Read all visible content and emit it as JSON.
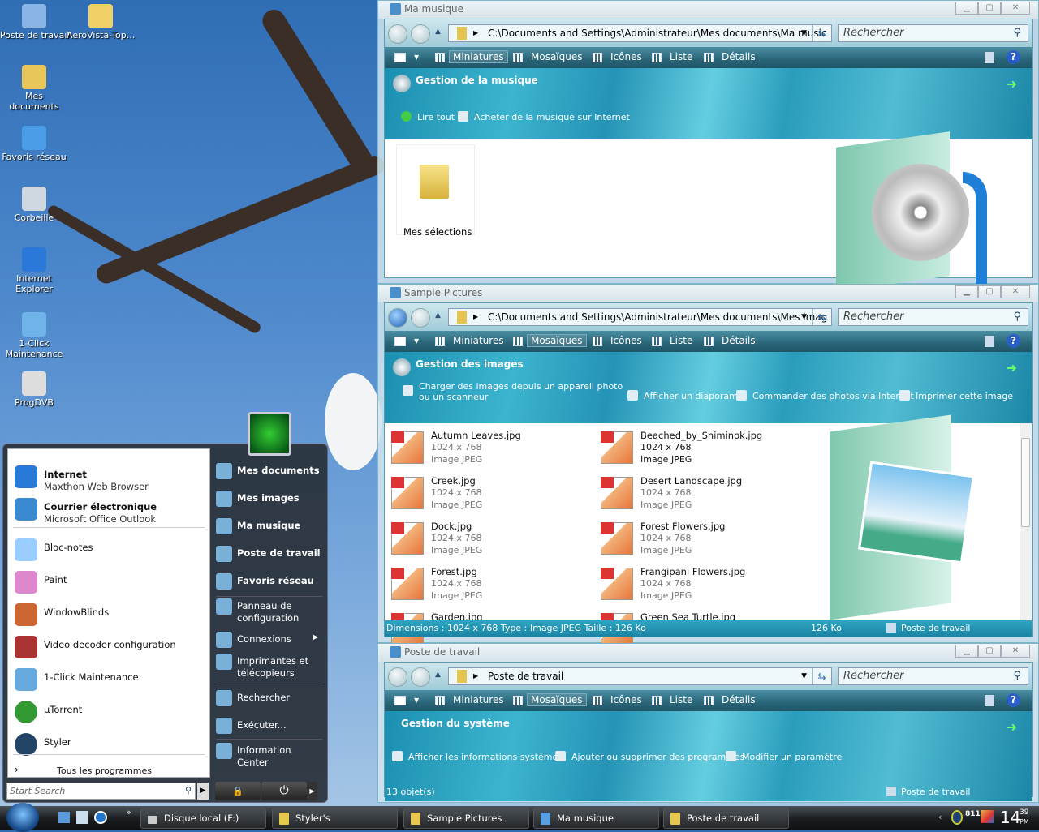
{
  "desktop": {
    "icons": [
      {
        "label": "Poste de travail",
        "icon": "computer-icon"
      },
      {
        "label": "AeroVista-Top...",
        "icon": "folder-icon"
      },
      {
        "label": "Mes documents",
        "icon": "documents-folder-icon"
      },
      {
        "label": "Favoris réseau",
        "icon": "network-icon"
      },
      {
        "label": "Corbeille",
        "icon": "recycle-bin-icon"
      },
      {
        "label": "Internet Explorer",
        "icon": "internet-explorer-icon"
      },
      {
        "label": "1-Click Maintenance",
        "icon": "maintenance-icon"
      },
      {
        "label": "ProgDVB",
        "icon": "satellite-dish-icon"
      }
    ]
  },
  "windows": [
    {
      "title": "Ma musique",
      "address": "C:\\Documents and Settings\\Administrateur\\Mes documents\\Ma music",
      "search": "Rechercher",
      "toolbar": [
        "Miniatures",
        "Mosaïques",
        "Icônes",
        "Liste",
        "Détails"
      ],
      "pane_title": "Gestion de la musique",
      "links": [
        "Lire tout",
        "Acheter de la musique sur Internet"
      ],
      "folders": [
        {
          "name": "Mes sélections"
        }
      ]
    },
    {
      "title": "Sample Pictures",
      "address": "C:\\Documents and Settings\\Administrateur\\Mes documents\\Mes imag",
      "search": "Rechercher",
      "toolbar": [
        "Miniatures",
        "Mosaïques",
        "Icônes",
        "Liste",
        "Détails"
      ],
      "pane_title": "Gestion des images",
      "links": [
        "Charger des images depuis un appareil photo ou un scanneur",
        "Afficher un diaporama",
        "Commander des photos via Internet",
        "Imprimer cette image"
      ],
      "files": [
        {
          "name": "Autumn Leaves.jpg",
          "dims": "1024 x 768",
          "type": "Image JPEG"
        },
        {
          "name": "Beached_by_Shiminok.jpg",
          "dims": "1024 x 768",
          "type": "Image JPEG"
        },
        {
          "name": "Creek.jpg",
          "dims": "1024 x 768",
          "type": "Image JPEG"
        },
        {
          "name": "Desert Landscape.jpg",
          "dims": "1024 x 768",
          "type": "Image JPEG"
        },
        {
          "name": "Dock.jpg",
          "dims": "1024 x 768",
          "type": "Image JPEG"
        },
        {
          "name": "Forest Flowers.jpg",
          "dims": "1024 x 768",
          "type": "Image JPEG"
        },
        {
          "name": "Forest.jpg",
          "dims": "1024 x 768",
          "type": "Image JPEG"
        },
        {
          "name": "Frangipani Flowers.jpg",
          "dims": "1024 x 768",
          "type": "Image JPEG"
        },
        {
          "name": "Garden.jpg",
          "dims": "",
          "type": ""
        },
        {
          "name": "Green Sea Turtle.jpg",
          "dims": "",
          "type": ""
        }
      ],
      "status": {
        "details": "Dimensions : 1024 x 768 Type : Image JPEG Taille  : 126 Ko",
        "size": "126 Ko",
        "location": "Poste de travail"
      }
    },
    {
      "title": "Poste de travail",
      "address": "Poste de travail",
      "search": "Rechercher",
      "toolbar": [
        "Miniatures",
        "Mosaïques",
        "Icônes",
        "Liste",
        "Détails"
      ],
      "pane_title": "Gestion du système",
      "links": [
        "Afficher les informations système",
        "Ajouter ou supprimer des programmes",
        "Modifier un paramètre"
      ],
      "status": {
        "details": "13 objet(s)",
        "location": "Poste de travail"
      }
    }
  ],
  "start_menu": {
    "pinned": [
      {
        "title": "Internet",
        "sub": "Maxthon Web Browser"
      },
      {
        "title": "Courrier électronique",
        "sub": "Microsoft Office Outlook"
      }
    ],
    "recent": [
      "Bloc-notes",
      "Paint",
      "WindowBlinds",
      "Video decoder configuration",
      "1-Click Maintenance",
      "µTorrent",
      "Styler"
    ],
    "all_programs": "Tous les programmes",
    "search_placeholder": "Start Search",
    "right": [
      "Mes documents",
      "Mes images",
      "Ma musique",
      "Poste de travail",
      "Favoris réseau",
      "Panneau de configuration",
      "Connexions",
      "Imprimantes et télécopieurs",
      "Rechercher",
      "Exécuter...",
      "Information Center"
    ]
  },
  "taskbar": {
    "buttons": [
      "Disque local (F:)",
      "Styler's",
      "Sample Pictures",
      "Ma musique",
      "Poste de travail"
    ],
    "clock_hour": "14",
    "clock_min": "39",
    "clock_ampm": "PM",
    "chevron": "»",
    "tray_text": "811"
  }
}
